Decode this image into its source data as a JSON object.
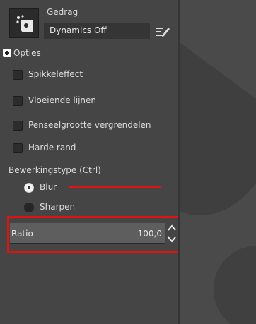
{
  "dynamics": {
    "label": "Gedrag",
    "value": "Dynamics Off"
  },
  "options": {
    "label": "Opties",
    "checkboxes": [
      {
        "label": "Spikkeleffect",
        "checked": false
      },
      {
        "label": "Vloeiende lijnen",
        "checked": false
      },
      {
        "label": "Penseelgrootte vergrendelen",
        "checked": false
      },
      {
        "label": "Harde rand",
        "checked": false
      }
    ]
  },
  "convolve_type": {
    "title": "Bewerkingstype (Ctrl)",
    "options": [
      {
        "label": "Blur",
        "selected": true
      },
      {
        "label": "Sharpen",
        "selected": false
      }
    ]
  },
  "ratio": {
    "label": "Ratio",
    "value": "100,0"
  },
  "colors": {
    "panel": "#454545",
    "field": "#353535",
    "highlight": "#e01313"
  },
  "icons": {
    "brush_preview": "brush-preview-icon",
    "edit_dynamics": "edit-dynamics-icon",
    "options": "plus-badge-icon",
    "spin_up": "chevron-up-icon",
    "spin_down": "chevron-down-icon"
  }
}
